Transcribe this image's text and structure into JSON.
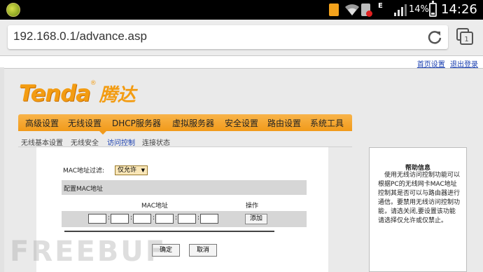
{
  "status_bar": {
    "network_type": "E",
    "battery": "14%",
    "time": "14:26"
  },
  "browser": {
    "url": "192.168.0.1/advance.asp",
    "tab_count": "1"
  },
  "header_links": {
    "home": "首页设置",
    "logout": "退出登录"
  },
  "logo": {
    "brand_en": "Tenda",
    "reg_mark": "®",
    "brand_cn": "腾达"
  },
  "nav": {
    "items": [
      "高级设置",
      "无线设置",
      "DHCP服务器",
      "虚拟服务器",
      "安全设置",
      "路由设置",
      "系统工具"
    ],
    "active": "无线设置"
  },
  "subnav": {
    "items": [
      "无线基本设置",
      "无线安全",
      "访问控制",
      "连接状态"
    ],
    "active": "访问控制"
  },
  "form": {
    "filter_label": "MAC地址过滤:",
    "filter_value": "仅允许",
    "section_title": "配置MAC地址",
    "col_mac": "MAC地址",
    "col_action": "操作",
    "mac_separator": ":",
    "add_button": "添加",
    "ok_button": "确定",
    "cancel_button": "取消"
  },
  "help": {
    "title": "帮助信息",
    "text": "使用无线访问控制功能可以根据PC的无线网卡MAC地址控制其是否可以与路由器进行通信。要禁用无线访问控制功能，请选关闭,要设置该功能请选择仅允许或仅禁止。"
  },
  "watermark": "FREEBUF"
}
